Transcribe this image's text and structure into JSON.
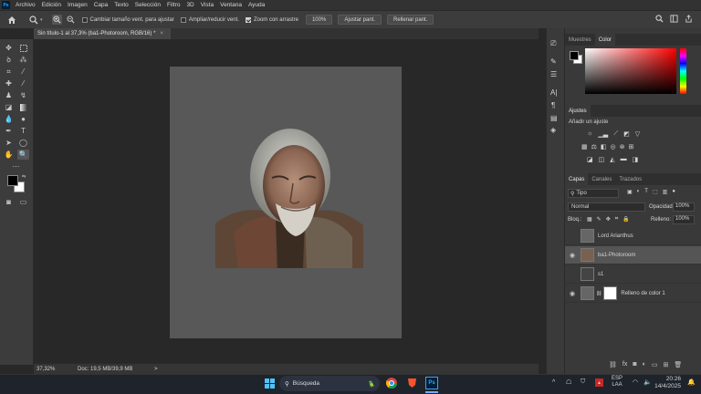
{
  "menubar": {
    "logo": "Ps",
    "items": [
      "Archivo",
      "Edición",
      "Imagen",
      "Capa",
      "Texto",
      "Selección",
      "Filtro",
      "3D",
      "Vista",
      "Ventana",
      "Ayuda"
    ]
  },
  "options": {
    "cambiar_label": "Cambiar tamaño vent. para ajustar",
    "ampliar_label": "Ampliar/reducir vent.",
    "zoom_drag_label": "Zoom con arrastre",
    "zoom_value": "100%",
    "ajustar_label": "Ajustar pant.",
    "rellenar_label": "Rellenar pant."
  },
  "document": {
    "tab_title": "Sin título-1 al 37,3% (ba1-Photoroom, RGB/16) *"
  },
  "status": {
    "zoom": "37,32%",
    "doc_info": "Doc: 19,5 MB/39,9 MB",
    "arrow": ">"
  },
  "panels": {
    "color_tabs": [
      "Muestres",
      "Color"
    ],
    "ajustes_tab": "Ajustes",
    "ajustes_hint": "Añadir un ajuste",
    "layer_tabs": [
      "Capas",
      "Canales",
      "Trazados"
    ],
    "filter_kind": "Tipo",
    "blend_mode": "Normal",
    "opacity_label": "Opacidad:",
    "opacity_value": "100%",
    "lock_label": "Bloq.:",
    "fill_label": "Relleno:",
    "fill_value": "100%",
    "layers": [
      {
        "name": "Lord Arianthus",
        "visible": false
      },
      {
        "name": "ba1-Photoroom",
        "visible": true,
        "selected": true
      },
      {
        "name": "s1",
        "visible": false
      },
      {
        "name": "Relleno de color 1",
        "visible": true
      }
    ]
  },
  "colors": {
    "accent_red": "#ff0000",
    "foreground": "#000000",
    "background": "#ffffff"
  },
  "taskbar": {
    "search_placeholder": "Búsqueda",
    "lang_top": "ESP",
    "lang_bottom": "LAA",
    "time": "20:26",
    "date": "14/4/2025"
  }
}
